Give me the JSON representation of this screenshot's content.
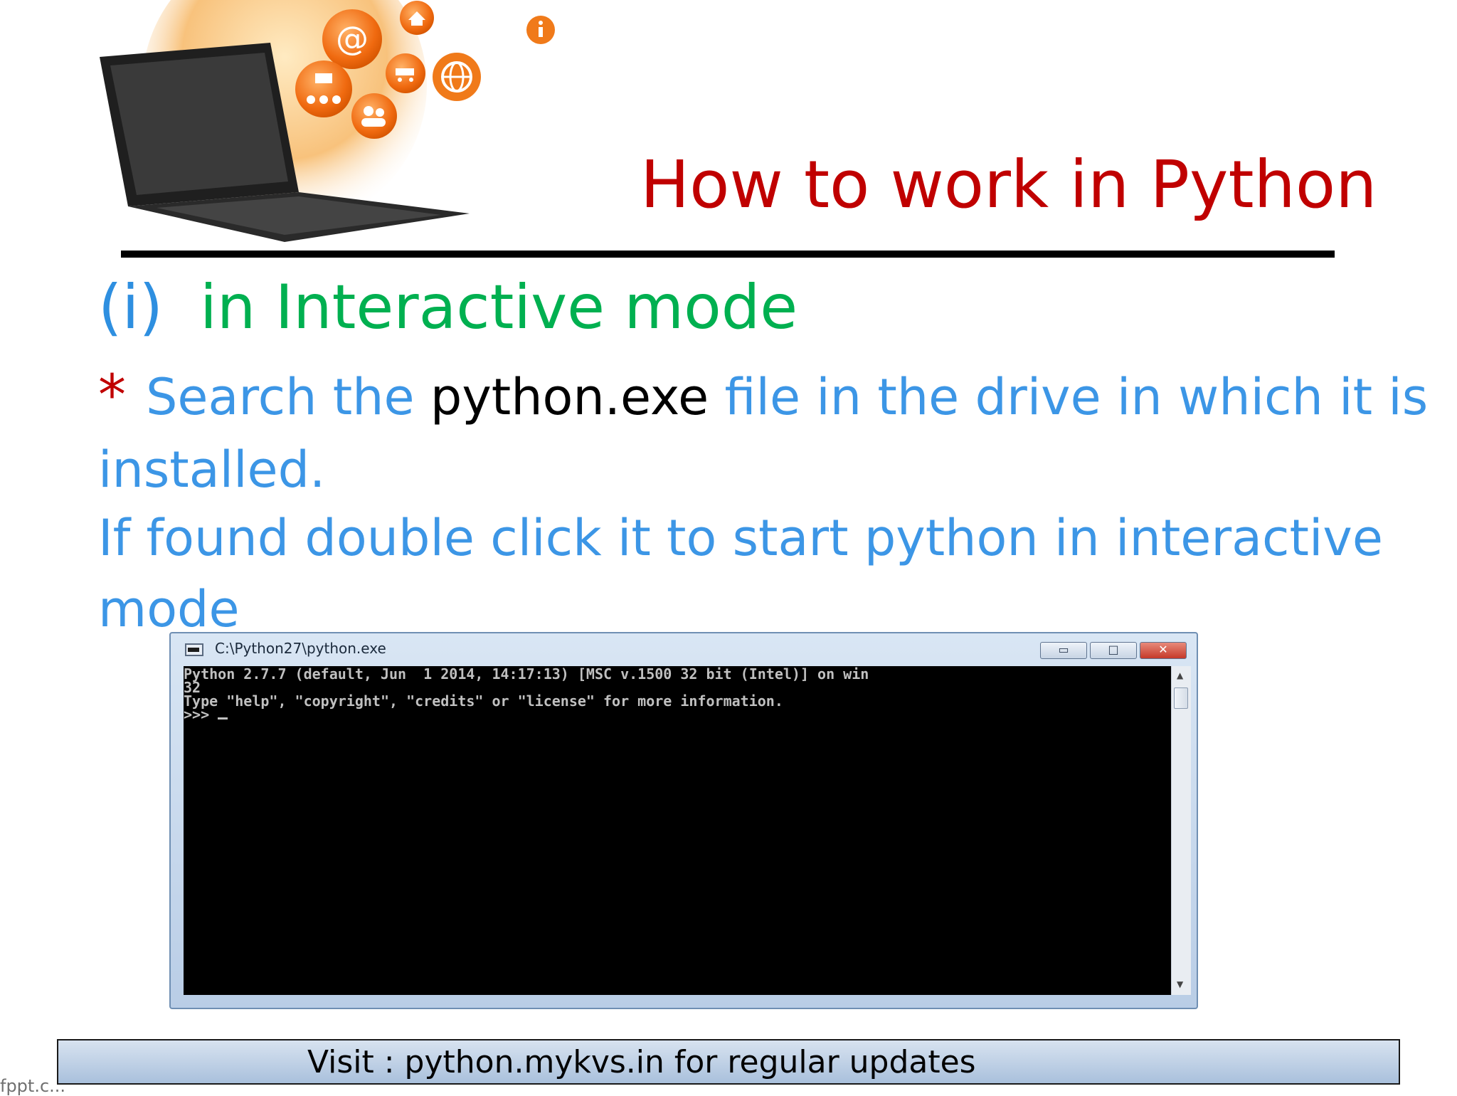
{
  "slide": {
    "title": "How to work in Python",
    "subtitle_number": "(i)",
    "subtitle_text": "in Interactive mode",
    "bullet_mark": "*",
    "line1_part1": "Search the",
    "line1_exe": "python.exe",
    "line1_part2": "file in the drive in which it is",
    "line2": "installed.",
    "line3": "If found double click it to start python in interactive",
    "line4": "mode"
  },
  "console": {
    "title": "C:\\Python27\\python.exe",
    "minimize_label": "▭",
    "maximize_label": "□",
    "close_label": "✕",
    "line1": "Python 2.7.7 (default, Jun  1 2014, 14:17:13) [MSC v.1500 32 bit (Intel)] on win",
    "line2": "32",
    "line3": "Type \"help\", \"copyright\", \"credits\" or \"license\" for more information.",
    "prompt": ">>> "
  },
  "footer": {
    "text": "Visit : python.mykvs.in for regular updates",
    "watermark": "fppt.c..."
  },
  "icons": [
    "laptop-icon",
    "email-at-icon",
    "home-icon",
    "info-icon",
    "shopping-cart-icon",
    "globe-icon",
    "sitemap-icon",
    "users-icon"
  ],
  "colors": {
    "title": "#c00000",
    "subtitle_number": "#2e8fe0",
    "subtitle_text": "#00b050",
    "body": "#3c96e6",
    "accent_orange": "#f07a1a"
  }
}
